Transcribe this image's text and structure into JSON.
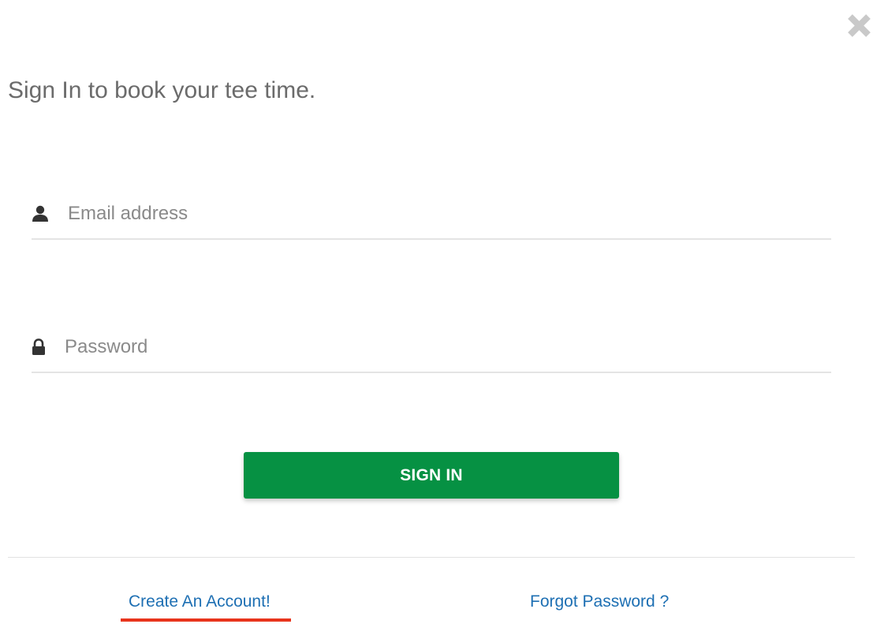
{
  "dialog": {
    "title": "Sign In to book your tee time.",
    "close_icon": "close-icon"
  },
  "form": {
    "email": {
      "icon": "user-icon",
      "placeholder": "Email address",
      "value": ""
    },
    "password": {
      "icon": "lock-icon",
      "placeholder": "Password",
      "value": ""
    },
    "submit_label": "SIGN IN"
  },
  "footer": {
    "create_account_label": "Create An Account!",
    "forgot_password_label": "Forgot Password ?"
  },
  "colors": {
    "primary_button": "#069143",
    "link": "#1d6fb3",
    "highlight_underline": "#e8341c",
    "title_text": "#6b6b6b"
  }
}
